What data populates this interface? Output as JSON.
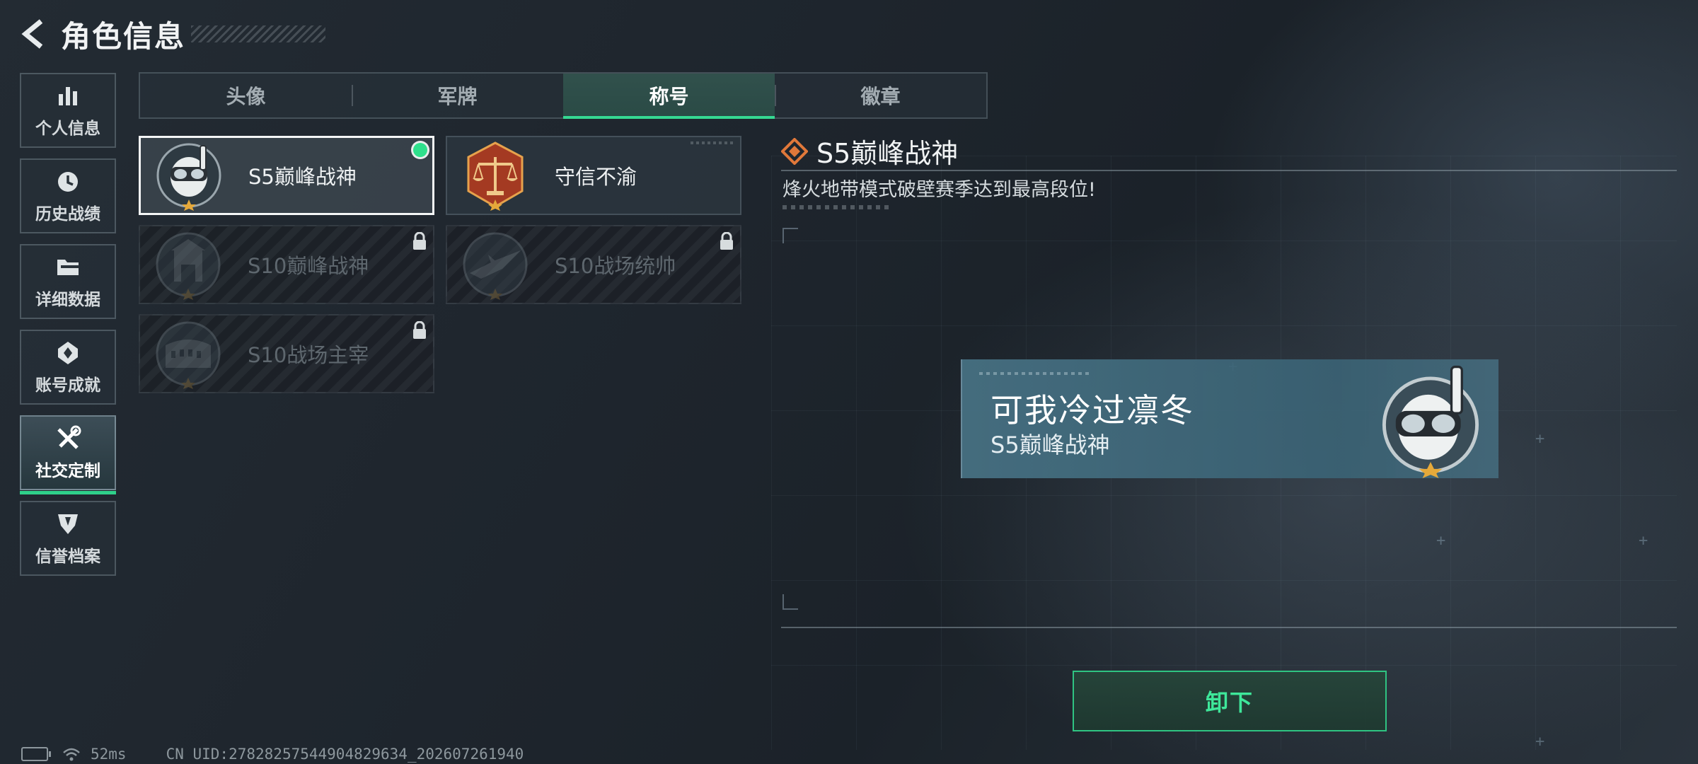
{
  "header": {
    "title": "角色信息"
  },
  "sidebar": {
    "items": [
      {
        "label": "个人信息",
        "icon": "bar-chart-icon"
      },
      {
        "label": "历史战绩",
        "icon": "clock-icon"
      },
      {
        "label": "详细数据",
        "icon": "folder-icon"
      },
      {
        "label": "账号成就",
        "icon": "achievement-icon"
      },
      {
        "label": "社交定制",
        "icon": "tools-icon",
        "active": true
      },
      {
        "label": "信誉档案",
        "icon": "shield-icon"
      }
    ]
  },
  "tabs": [
    {
      "label": "头像"
    },
    {
      "label": "军牌"
    },
    {
      "label": "称号",
      "active": true
    },
    {
      "label": "徽章"
    }
  ],
  "titles": [
    {
      "name": "S5巅峰战神",
      "state": "equipped",
      "emblem": "diver-skull-emblem"
    },
    {
      "name": "守信不渝",
      "state": "unlocked",
      "emblem": "scales-emblem"
    },
    {
      "name": "S10巅峰战神",
      "state": "locked",
      "emblem": "tower-emblem"
    },
    {
      "name": "S10战场统帅",
      "state": "locked",
      "emblem": "aircraft-emblem"
    },
    {
      "name": "S10战场主宰",
      "state": "locked",
      "emblem": "colosseum-emblem"
    }
  ],
  "detail": {
    "title": "S5巅峰战神",
    "description": "烽火地带模式破壁赛季达到最高段位!"
  },
  "preview": {
    "player_name": "可我冷过凛冬",
    "title": "S5巅峰战神"
  },
  "actions": {
    "unequip_label": "卸下"
  },
  "status": {
    "ping": "52ms",
    "uid": "CN UID:27828257544904829634_202607261940"
  },
  "colors": {
    "accent": "#2fd08a",
    "equipped_dot": "#2fe08c",
    "emblem_orange": "#e0783a"
  }
}
